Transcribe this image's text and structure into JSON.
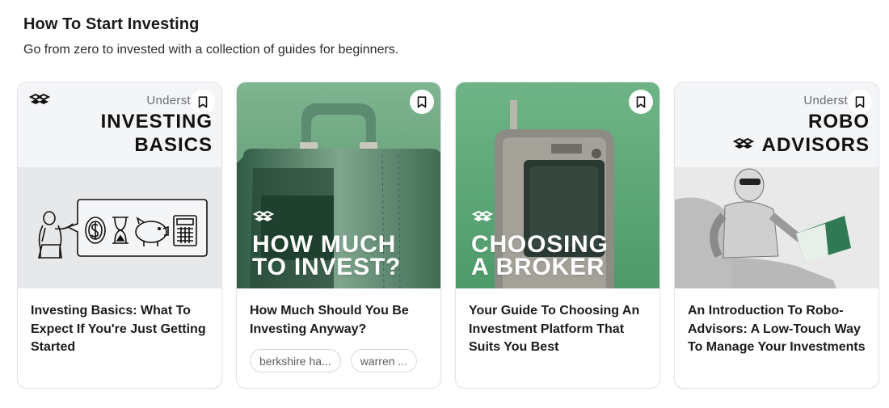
{
  "section": {
    "title": "How To Start Investing",
    "subtitle": "Go from zero to invested with a collection of guides for beginners."
  },
  "cards": [
    {
      "title": "Investing Basics: What To Expect If You're Just Getting Started",
      "thumb_kicker": "Underst",
      "thumb_line1": "INVESTING",
      "thumb_line2": "BASICS",
      "thumb_style": "illustration"
    },
    {
      "title": "How Much Should You Be Investing Anyway?",
      "thumb_line1": "HOW MUCH",
      "thumb_line2": "TO INVEST?",
      "thumb_style": "photo-suitcase",
      "tags": [
        "berkshire ha...",
        "warren ..."
      ]
    },
    {
      "title": "Your Guide To Choosing An Investment Platform That Suits You Best",
      "thumb_line1": "CHOOSING",
      "thumb_line2": "A BROKER",
      "thumb_style": "photo-device"
    },
    {
      "title": "An Introduction To Robo-Advisors: A Low-Touch Way To Manage Your Investments",
      "thumb_kicker": "Underst",
      "thumb_line1": "ROBO",
      "thumb_line2": "ADVISORS",
      "thumb_style": "photo-robot"
    }
  ],
  "icons": {
    "bookmark": "bookmark-icon",
    "logo": "brand-logo-icon"
  },
  "colors": {
    "accent_green": "#5f9f78",
    "card_border": "#e2e4e8",
    "strip_gray": "#f4f5f7"
  }
}
